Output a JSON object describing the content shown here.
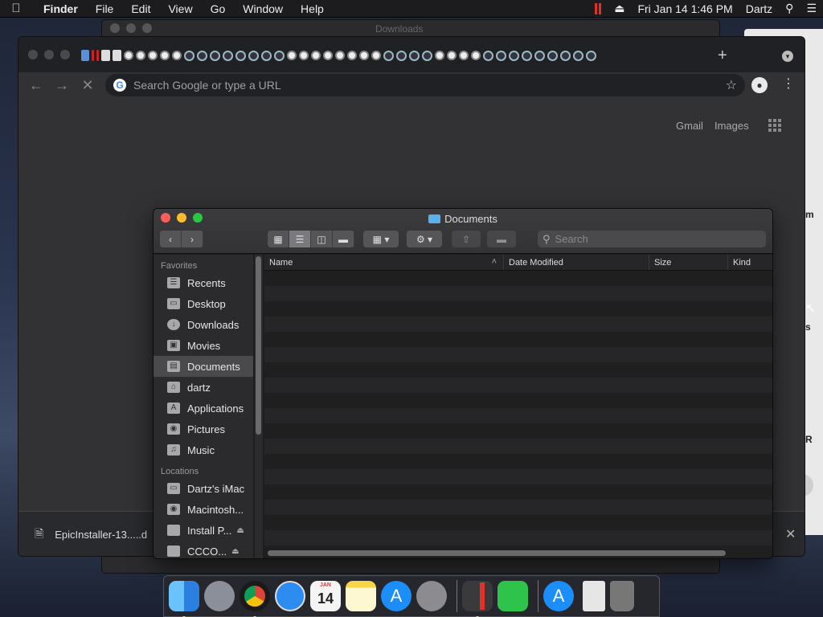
{
  "menubar": {
    "app_name": "Finder",
    "menus": [
      "File",
      "Edit",
      "View",
      "Go",
      "Window",
      "Help"
    ],
    "datetime": "Fri Jan 14  1:46 PM",
    "user": "Dartz"
  },
  "background_window": {
    "title": "Downloads",
    "right_peek_labels": [
      "m",
      "s",
      "R"
    ],
    "right_peek_button": "e"
  },
  "chrome": {
    "omnibox_placeholder": "Search Google or type a URL",
    "ntp_links": {
      "gmail": "Gmail",
      "images": "Images"
    },
    "download_file": "EpicInstaller-13.....d"
  },
  "finder": {
    "title": "Documents",
    "search_placeholder": "Search",
    "sidebar": {
      "favorites_header": "Favorites",
      "favorites": [
        {
          "label": "Recents",
          "icon": "recents-icon"
        },
        {
          "label": "Desktop",
          "icon": "desktop-icon"
        },
        {
          "label": "Downloads",
          "icon": "downloads-icon"
        },
        {
          "label": "Movies",
          "icon": "movies-icon"
        },
        {
          "label": "Documents",
          "icon": "documents-icon"
        },
        {
          "label": "dartz",
          "icon": "home-icon"
        },
        {
          "label": "Applications",
          "icon": "applications-icon"
        },
        {
          "label": "Pictures",
          "icon": "pictures-icon"
        },
        {
          "label": "Music",
          "icon": "music-icon"
        }
      ],
      "selected": "Documents",
      "locations_header": "Locations",
      "locations": [
        {
          "label": "Dartz's iMac",
          "icon": "imac-icon"
        },
        {
          "label": "Macintosh...",
          "icon": "disk-icon"
        },
        {
          "label": "Install P...",
          "icon": "disk-icon"
        },
        {
          "label": "CCCO...",
          "icon": "disk-icon"
        }
      ]
    },
    "columns": [
      "Name",
      "Date Modified",
      "Size",
      "Kind"
    ]
  },
  "dock": {
    "calendar_month": "JAN",
    "calendar_day": "14"
  },
  "colors": {
    "accent_red": "#e0312b",
    "traffic_red": "#fc5f57",
    "traffic_yellow": "#fdbc2e",
    "traffic_green": "#28c840",
    "folder_blue": "#5ab0e8"
  }
}
